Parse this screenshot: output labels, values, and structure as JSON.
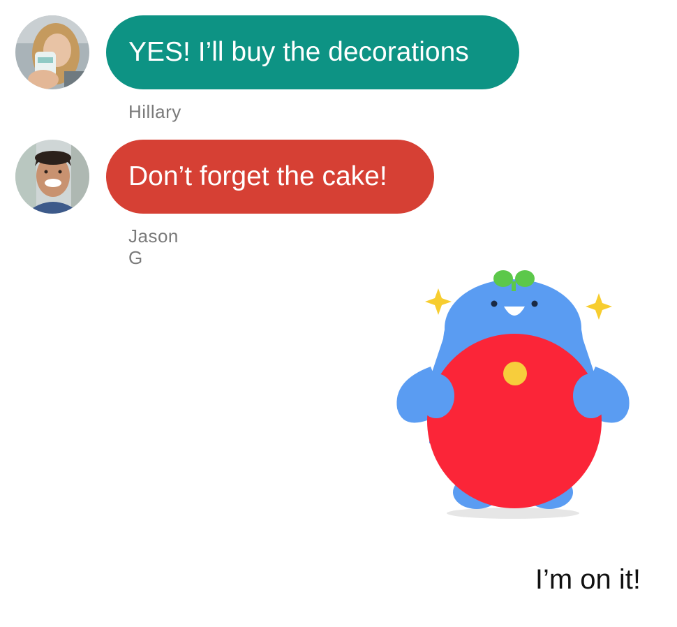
{
  "conversation": {
    "messages": [
      {
        "sender": "Hillary",
        "text": "YES! I’ll buy the decorations",
        "bubble_color": "#0d9384"
      },
      {
        "sender": "Jason G",
        "text": "Don’t forget the cake!",
        "bubble_color": "#d64034"
      }
    ],
    "sticker": {
      "icon": "blue-mascot-sticker"
    },
    "own_message": {
      "text": "I’m on it!"
    }
  }
}
